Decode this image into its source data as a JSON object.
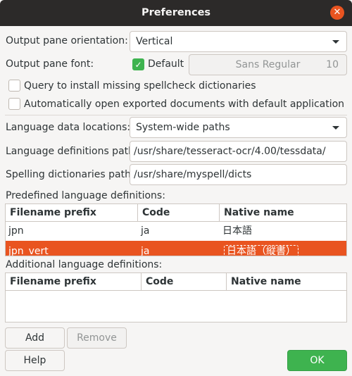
{
  "window": {
    "title": "Preferences",
    "close_icon": "close-icon"
  },
  "orientation": {
    "label": "Output pane orientation:",
    "value": "Vertical"
  },
  "font": {
    "label": "Output pane font:",
    "default_label": "Default",
    "default_checked": true,
    "font_name": "Sans Regular",
    "font_size": "10"
  },
  "options": [
    {
      "label": "Query to install missing spellcheck dictionaries",
      "checked": false
    },
    {
      "label": "Automatically open exported documents with default application",
      "checked": false
    }
  ],
  "language_data": {
    "label": "Language data locations:",
    "value": "System-wide paths"
  },
  "lang_defs_path": {
    "label": "Language definitions path:",
    "value": "/usr/share/tesseract-ocr/4.00/tessdata/"
  },
  "spelling_path": {
    "label": "Spelling dictionaries path:",
    "value": "/usr/share/myspell/dicts"
  },
  "predefined": {
    "label": "Predefined language definitions:",
    "columns": [
      "Filename prefix",
      "Code",
      "Native name"
    ],
    "rows": [
      [
        "jpn",
        "ja",
        "日本語"
      ],
      [
        "jpn_vert",
        "ja",
        "日本語（縦書）"
      ]
    ],
    "selected_row": 1
  },
  "additional": {
    "label": "Additional language definitions:",
    "columns": [
      "Filename prefix",
      "Code",
      "Native name"
    ],
    "rows": []
  },
  "buttons": {
    "add": "Add",
    "remove": "Remove",
    "help": "Help",
    "ok": "OK"
  },
  "colors": {
    "accent": "#e95420",
    "ok": "#3eb34f",
    "check": "#3eb34f"
  }
}
